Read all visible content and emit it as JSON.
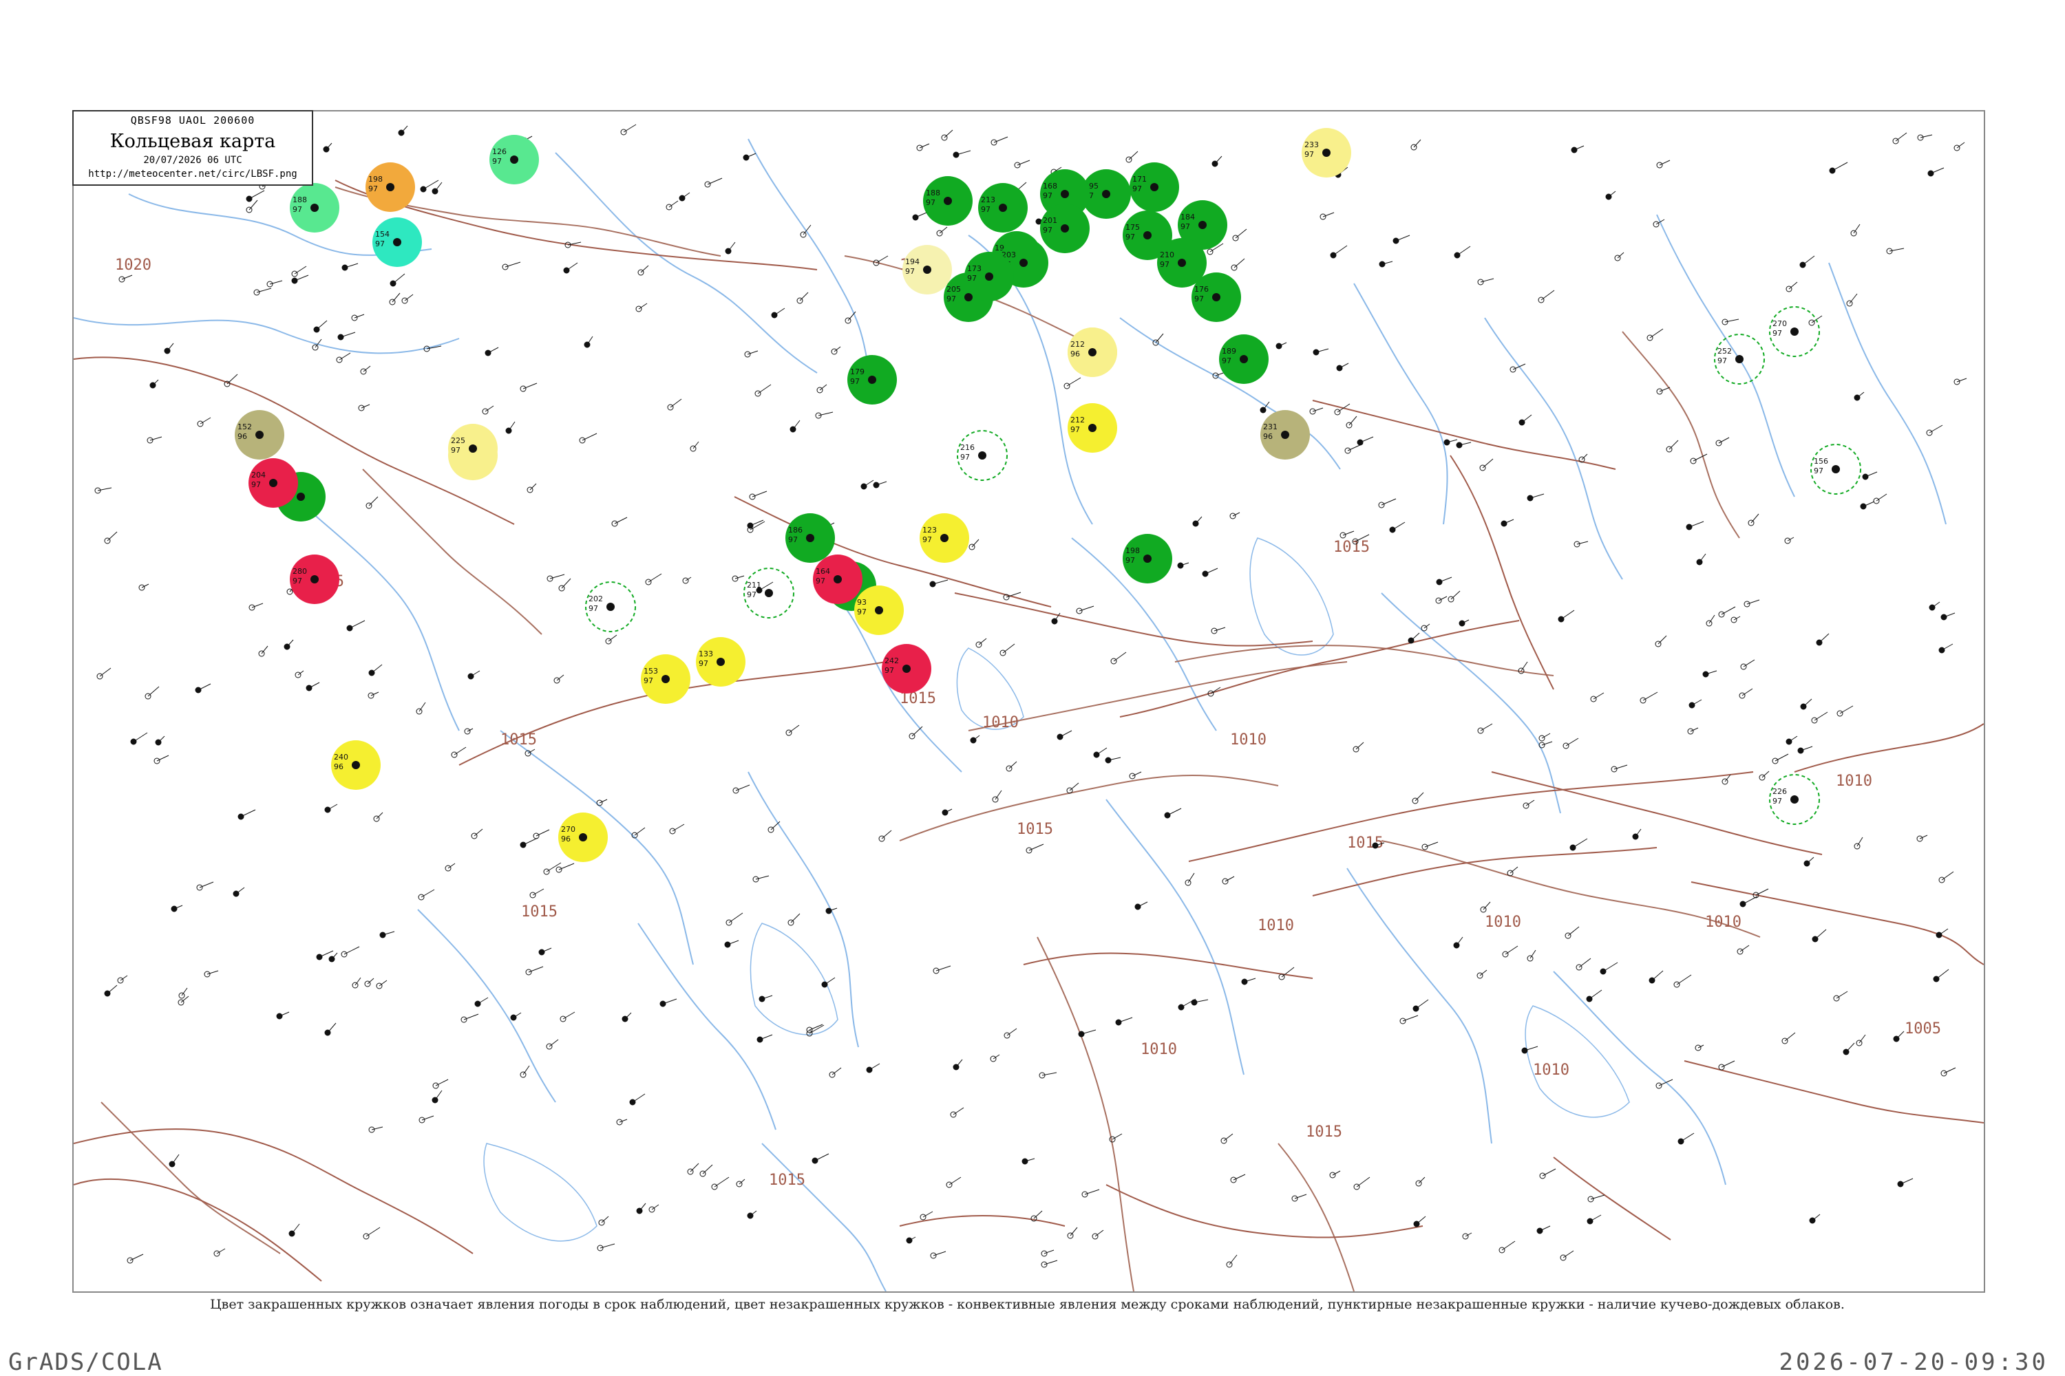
{
  "header": {
    "code": "QBSF98  UAOL  200600",
    "title": "Кольцевая карта",
    "datetime": "20/07/2026 06 UTC",
    "url": "http://meteocenter.net/circ/LBSF.png"
  },
  "legend": {
    "text": "Цвет закрашенных кружков означает явления погоды в срок наблюдений, цвет незакрашенных кружков - конвективные явления между сроками наблюдений, пунктирные незакрашенные кружки - наличие кучево-дождевых облаков."
  },
  "footer": {
    "left": "GrADS/COLA",
    "right": "2026-07-20-09:30"
  },
  "colors": {
    "isobar": "#a05a4a",
    "river": "#8ab8e8",
    "border": "#a87060",
    "green": "#11aa22",
    "yellow": "#f5ef30",
    "red": "#e8204a",
    "orange": "#f2a93c",
    "cyan": "#2ee8c0",
    "olive": "#b7b37a",
    "light_green": "#58e890",
    "light_yellow": "#f8f08c",
    "pale_yellow": "#f6f2b0"
  },
  "isobar_labels": [
    "1015",
    "1020",
    "1015",
    "1015",
    "1010",
    "1015",
    "1015",
    "1010",
    "1015",
    "1010",
    "1010",
    "1015",
    "1010",
    "1010",
    "1010",
    "1005",
    "1015",
    "1015",
    "1010",
    "1010"
  ],
  "stations": [
    {
      "t": "213",
      "p": "97",
      "c": "green"
    },
    {
      "t": "194",
      "p": "97",
      "c": "green"
    },
    {
      "t": "188",
      "p": "97",
      "c": "green"
    },
    {
      "t": "203",
      "p": "96",
      "c": "green"
    },
    {
      "t": "195",
      "p": "97",
      "c": "green"
    },
    {
      "t": "168",
      "p": "97",
      "c": "green"
    },
    {
      "t": "171",
      "p": "97",
      "c": "green"
    },
    {
      "t": "175",
      "p": "97",
      "c": "green"
    },
    {
      "t": "184",
      "p": "97",
      "c": "green"
    },
    {
      "t": "205",
      "p": "97",
      "c": "green"
    },
    {
      "t": "176",
      "p": "97",
      "c": "green"
    },
    {
      "t": "173",
      "p": "97",
      "c": "green"
    },
    {
      "t": "201",
      "p": "97",
      "c": "green"
    },
    {
      "t": "210",
      "p": "97",
      "c": "green"
    },
    {
      "t": "189",
      "p": "97",
      "c": "green"
    },
    {
      "t": "179",
      "p": "97",
      "c": "green"
    },
    {
      "t": "186",
      "p": "97",
      "c": "green"
    },
    {
      "t": "198",
      "p": "97",
      "c": "green"
    },
    {
      "t": "202",
      "p": "97",
      "c": "green"
    },
    {
      "t": "193",
      "p": "97",
      "c": "green"
    },
    {
      "t": "212",
      "p": "97",
      "c": "yellow"
    },
    {
      "t": "123",
      "p": "97",
      "c": "yellow"
    },
    {
      "t": "93",
      "p": "97",
      "c": "yellow"
    },
    {
      "t": "133",
      "p": "97",
      "c": "yellow"
    },
    {
      "t": "153",
      "p": "97",
      "c": "yellow"
    },
    {
      "t": "240",
      "p": "96",
      "c": "yellow"
    },
    {
      "t": "270",
      "p": "96",
      "c": "yellow"
    },
    {
      "t": "233",
      "p": "97",
      "c": "light_yellow"
    },
    {
      "t": "109",
      "p": "97",
      "c": "light_yellow"
    },
    {
      "t": "225",
      "p": "97",
      "c": "light_yellow"
    },
    {
      "t": "212",
      "p": "96",
      "c": "light_yellow"
    },
    {
      "t": "212",
      "p": "96",
      "c": "light_yellow"
    },
    {
      "t": "204",
      "p": "97",
      "c": "red"
    },
    {
      "t": "280",
      "p": "97",
      "c": "red"
    },
    {
      "t": "164",
      "p": "97",
      "c": "red"
    },
    {
      "t": "242",
      "p": "97",
      "c": "red"
    },
    {
      "t": "198",
      "p": "97",
      "c": "orange"
    },
    {
      "t": "154",
      "p": "97",
      "c": "cyan"
    },
    {
      "t": "126",
      "p": "97",
      "c": "light_green"
    },
    {
      "t": "188",
      "p": "97",
      "c": "light_green"
    },
    {
      "t": "152",
      "p": "96",
      "c": "olive"
    },
    {
      "t": "231",
      "p": "96",
      "c": "olive"
    },
    {
      "t": "194",
      "p": "97",
      "c": "pale_yellow"
    },
    {
      "t": "216",
      "p": "97",
      "c": "ring"
    },
    {
      "t": "211",
      "p": "97",
      "c": "ring"
    },
    {
      "t": "202",
      "p": "97",
      "c": "ring"
    },
    {
      "t": "270",
      "p": "97",
      "c": "ring"
    },
    {
      "t": "252",
      "p": "97",
      "c": "ring"
    },
    {
      "t": "156",
      "p": "97",
      "c": "ring"
    },
    {
      "t": "226",
      "p": "97",
      "c": "ring"
    }
  ]
}
